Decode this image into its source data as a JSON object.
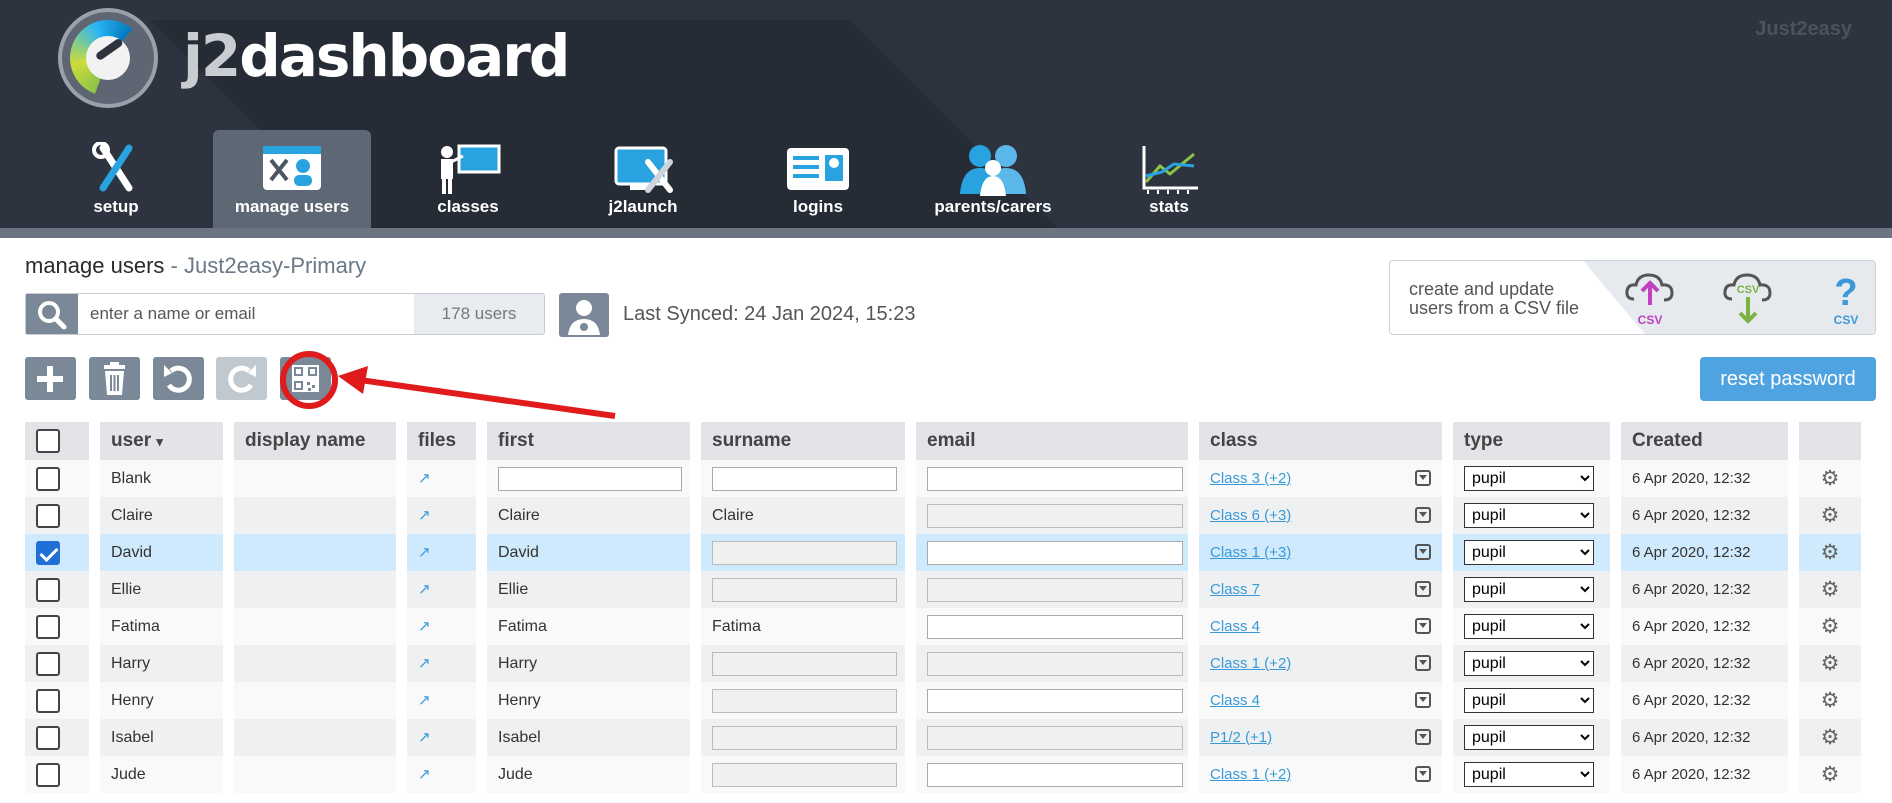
{
  "app": {
    "brand_prefix": "j2",
    "brand_suffix": "dashboard",
    "corner_brand": "Just2easy"
  },
  "nav": {
    "items": [
      {
        "label": "setup",
        "icon": "tools-icon"
      },
      {
        "label": "manage users",
        "icon": "manage-users-icon",
        "active": true
      },
      {
        "label": "classes",
        "icon": "teacher-board-icon"
      },
      {
        "label": "j2launch",
        "icon": "j2launch-icon"
      },
      {
        "label": "logins",
        "icon": "id-card-icon"
      },
      {
        "label": "parents/carers",
        "icon": "parents-icon"
      },
      {
        "label": "stats",
        "icon": "chart-icon"
      }
    ]
  },
  "page": {
    "title": "manage users",
    "separator": " - ",
    "school": "Just2easy-Primary"
  },
  "search": {
    "placeholder": "enter a name or email",
    "user_count": "178 users"
  },
  "sync": {
    "text": "Last Synced: 24 Jan 2024, 15:23"
  },
  "csv": {
    "text_line1": "create and update",
    "text_line2": "users from a CSV file",
    "upload_label": "CSV",
    "download_label": "CSV",
    "help_label": "CSV"
  },
  "toolbar": {
    "add": "add-icon",
    "delete": "trash-icon",
    "undo": "undo-icon",
    "redo": "redo-icon",
    "qr": "qr-code-icon",
    "reset_password": "reset password"
  },
  "table": {
    "headers": {
      "user": "user",
      "user_sort": "▾",
      "display_name": "display name",
      "files": "files",
      "first": "first",
      "surname": "surname",
      "email": "email",
      "class": "class",
      "type": "type",
      "created": "Created"
    },
    "rows": [
      {
        "user": "Blank",
        "first": "",
        "surname": "",
        "class": "Class 3 (+2)",
        "type": "pupil",
        "created": "6 Apr 2020, 12:32",
        "checked": false
      },
      {
        "user": "Claire",
        "first": "Claire",
        "surname": "Claire",
        "class": "Class 6 (+3)",
        "type": "pupil",
        "created": "6 Apr 2020, 12:32",
        "checked": false
      },
      {
        "user": "David",
        "first": "David",
        "surname": "",
        "class": "Class 1 (+3)",
        "type": "pupil",
        "created": "6 Apr 2020, 12:32",
        "checked": true
      },
      {
        "user": "Ellie",
        "first": "Ellie",
        "surname": "",
        "class": "Class 7",
        "type": "pupil",
        "created": "6 Apr 2020, 12:32",
        "checked": false
      },
      {
        "user": "Fatima",
        "first": "Fatima",
        "surname": "Fatima",
        "class": "Class 4",
        "type": "pupil",
        "created": "6 Apr 2020, 12:32",
        "checked": false
      },
      {
        "user": "Harry",
        "first": "Harry",
        "surname": "",
        "class": "Class 1 (+2)",
        "type": "pupil",
        "created": "6 Apr 2020, 12:32",
        "checked": false
      },
      {
        "user": "Henry",
        "first": "Henry",
        "surname": "",
        "class": "Class 4",
        "type": "pupil",
        "created": "6 Apr 2020, 12:32",
        "checked": false
      },
      {
        "user": "Isabel",
        "first": "Isabel",
        "surname": "",
        "class": "P1/2 (+1)",
        "type": "pupil",
        "created": "6 Apr 2020, 12:32",
        "checked": false
      },
      {
        "user": "Jude",
        "first": "Jude",
        "surname": "",
        "class": "Class 1 (+2)",
        "type": "pupil",
        "created": "6 Apr 2020, 12:32",
        "checked": false
      }
    ]
  },
  "colors": {
    "header_bg": "#2d3440",
    "accent": "#4fa3e0",
    "link": "#3a9ad9",
    "annotation_red": "#e01b1b",
    "selected_row": "#cfeafc"
  }
}
